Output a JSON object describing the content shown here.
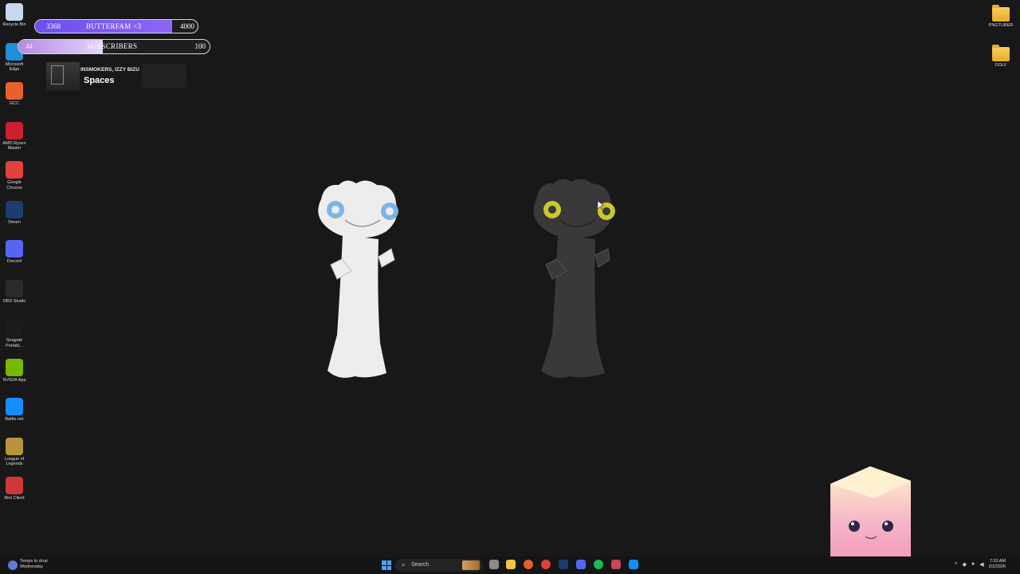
{
  "desktop": {
    "left_icons": [
      {
        "label": "Recycle Bin",
        "icon": "recycle-bin-icon",
        "color": "#c7d7ee"
      },
      {
        "label": "Microsoft Edge",
        "icon": "edge-icon",
        "color": "#1f8fd8"
      },
      {
        "label": "GCC",
        "icon": "gcc-icon",
        "color": "#e8612b"
      },
      {
        "label": "AMD Ryzen Master",
        "icon": "amd-ryzen-icon",
        "color": "#cc1f2f"
      },
      {
        "label": "Google Chrome",
        "icon": "chrome-icon",
        "color": "#e0413a"
      },
      {
        "label": "Steam",
        "icon": "steam-icon",
        "color": "#1b3d6f"
      },
      {
        "label": "Discord",
        "icon": "discord-icon",
        "color": "#5865f2"
      },
      {
        "label": "OBS Studio",
        "icon": "obs-icon",
        "color": "#2b2b2b"
      },
      {
        "label": "Seagate Portabl...",
        "icon": "seagate-icon",
        "color": "#1c1c1c"
      },
      {
        "label": "NVIDIA App",
        "icon": "nvidia-icon",
        "color": "#76b900"
      },
      {
        "label": "Battle.net",
        "icon": "battlenet-icon",
        "color": "#148eff"
      },
      {
        "label": "League of Legends",
        "icon": "league-icon",
        "color": "#b8953a"
      },
      {
        "label": "Riot Client",
        "icon": "riot-icon",
        "color": "#d13639"
      }
    ],
    "right_icons": [
      {
        "label": "PNGTUBER",
        "icon": "folder-icon"
      },
      {
        "label": "DOLF",
        "icon": "folder-icon"
      }
    ]
  },
  "overlay": {
    "goal": {
      "current": "3368",
      "title": "BUTTERFAM <3",
      "target": "4000",
      "progress": 0.842,
      "color": "#7a57f5"
    },
    "subscribers": {
      "current": "44",
      "title": "SUBSCRIBERS",
      "target": "100",
      "progress": 0.44,
      "color": "#c9a6f0"
    },
    "now_playing": {
      "artist": "INSMOKERS, IZZY BIZU",
      "title": "Spaces"
    }
  },
  "taskbar": {
    "weather_line1": "Temps to drop",
    "weather_line2": "Wednesday",
    "search_label": "Search",
    "clock_time": "7:33 AM",
    "clock_date": "2/2/2026"
  }
}
